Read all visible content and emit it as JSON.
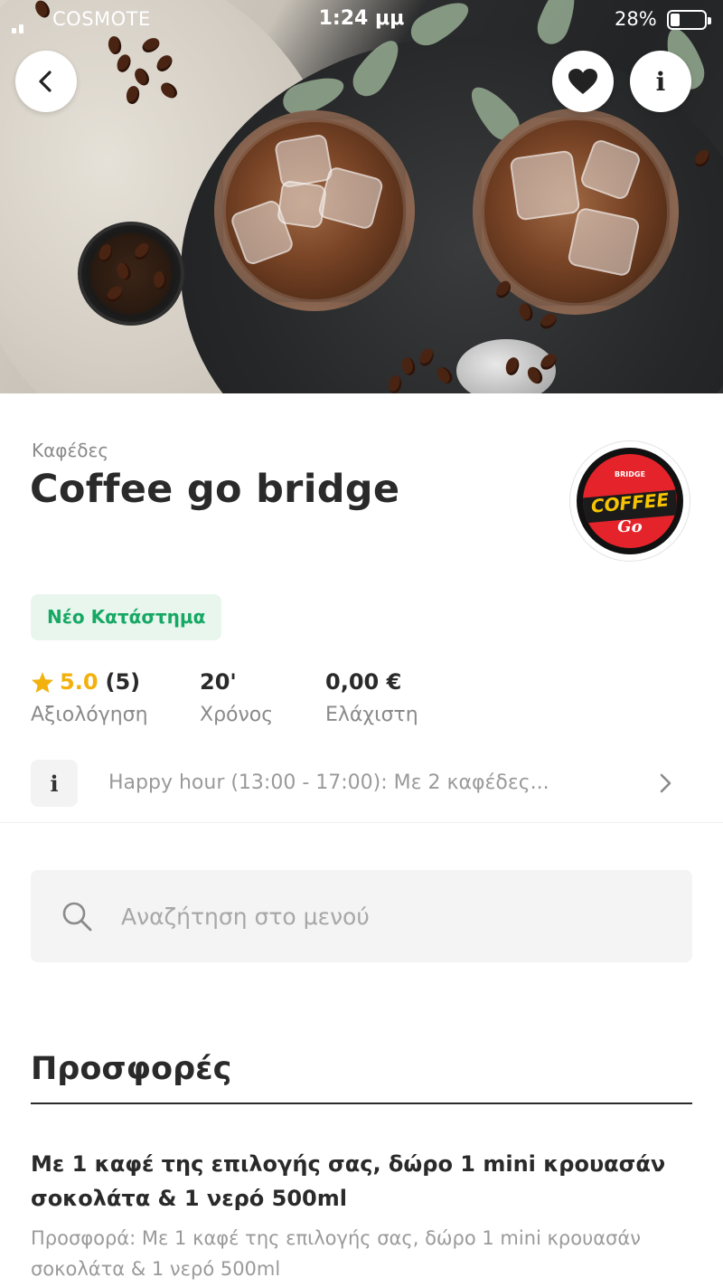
{
  "status_bar": {
    "carrier": "COSMOTE",
    "time": "1:24 μμ",
    "battery": "28%",
    "battery_level": 0.28
  },
  "header": {
    "back_icon": "chevron-left-icon",
    "favorite_icon": "heart-icon",
    "info_icon": "info-icon",
    "info_glyph": "i"
  },
  "store": {
    "category": "Καφέδες",
    "name": "Coffee go bridge",
    "logo": {
      "top_text": "BRIDGE",
      "main_text": "COFFEE",
      "sub_text": "Go"
    },
    "badge": "Νέο Κατάστημα",
    "rating": {
      "score": "5.0",
      "count": "(5)",
      "label": "Αξιολόγηση"
    },
    "time": {
      "value": "20'",
      "label": "Χρόνος"
    },
    "minimum": {
      "value": "0,00 €",
      "label": "Ελάχιστη"
    }
  },
  "notice": {
    "icon_glyph": "i",
    "text": "Happy hour (13:00 - 17:00): Με 2 καφέδες..."
  },
  "search": {
    "placeholder": "Αναζήτηση στο μενού",
    "value": ""
  },
  "offers": {
    "title": "Προσφορές",
    "items": [
      {
        "title": "Με 1 καφέ της επιλογής σας, δώρο 1 mini κρουασάν σοκολάτα & 1 νερό 500ml",
        "description": "Προσφορά: Με 1 καφέ της επιλογής σας, δώρο 1 mini κρουασάν σοκολάτα & 1 νερό 500ml"
      }
    ]
  },
  "colors": {
    "accent_green": "#17a864",
    "badge_bg": "#e8f6ee",
    "star": "#f2b10c"
  }
}
